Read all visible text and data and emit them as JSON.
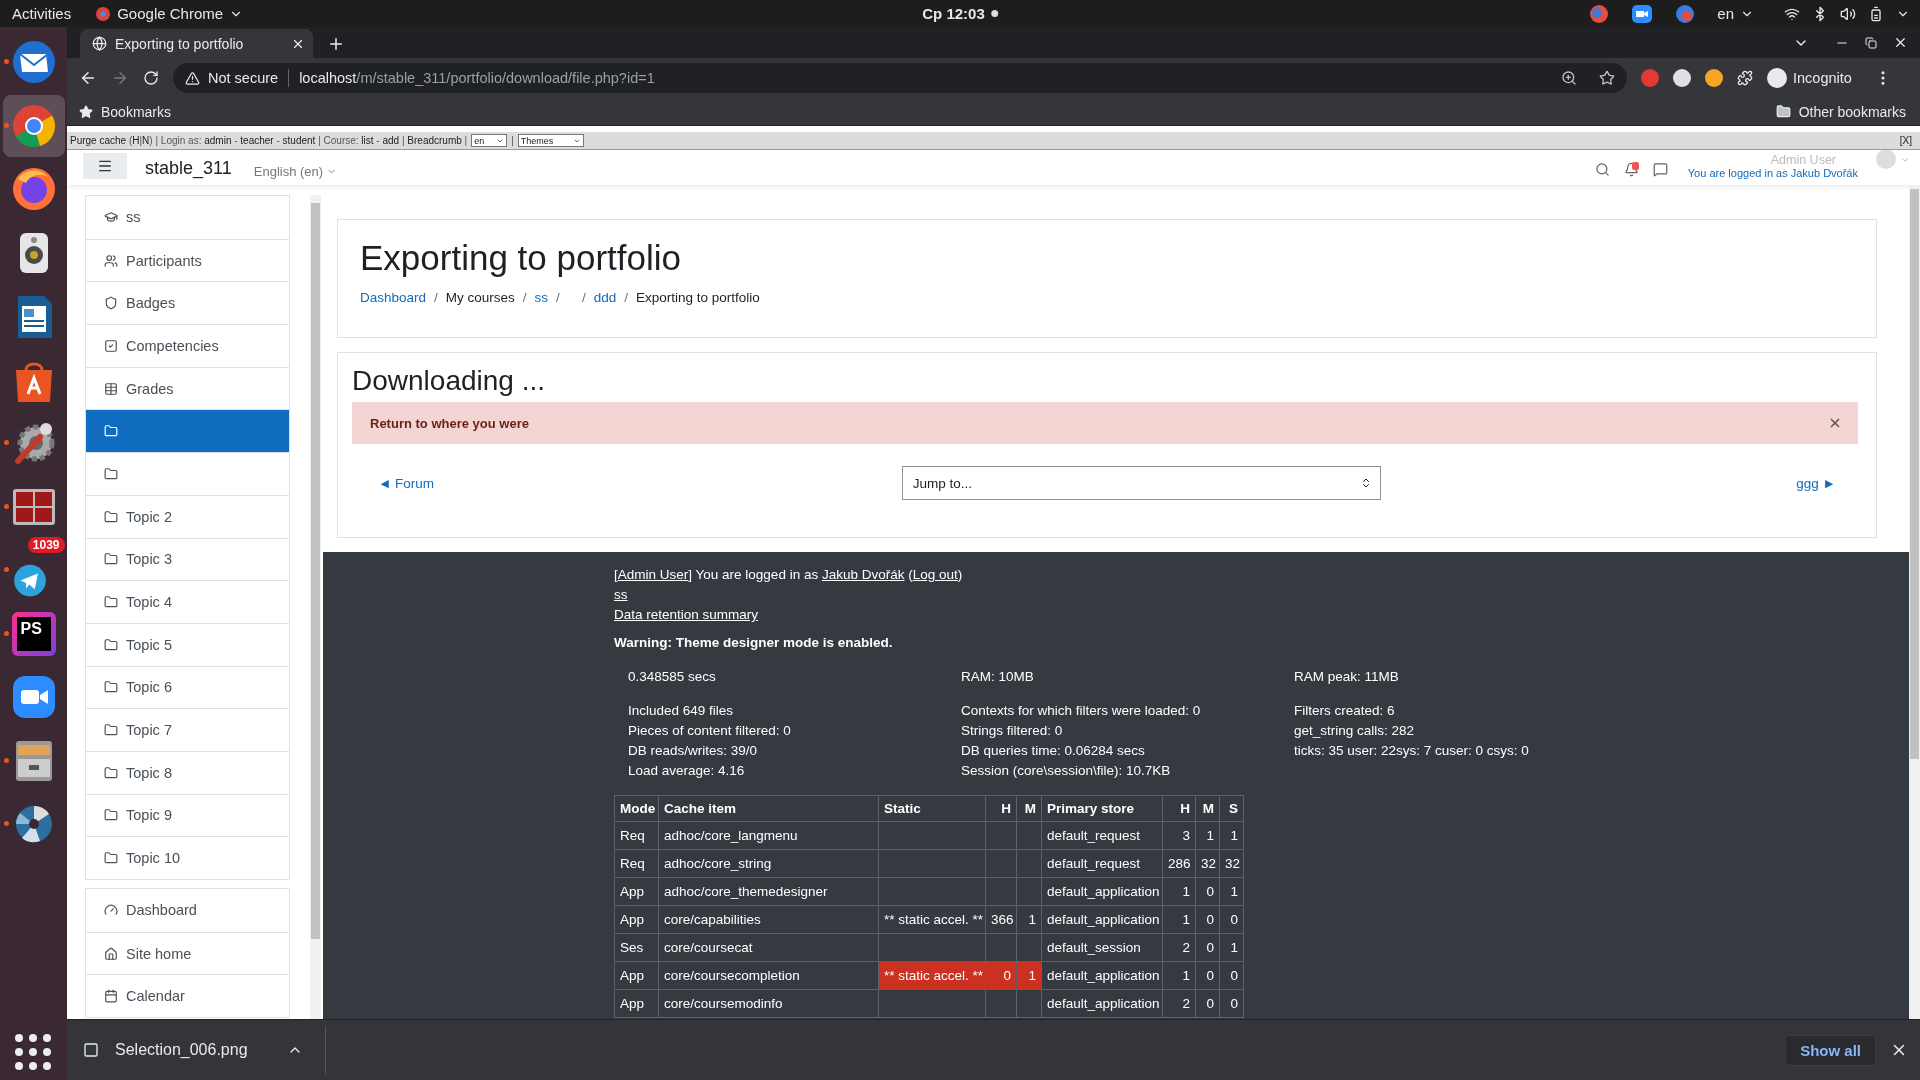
{
  "topbar": {
    "activities": "Activities",
    "app_menu": "Google Chrome",
    "clock": "Ср 12:03",
    "language": "en"
  },
  "dock": [
    {
      "kind": "mail",
      "running": true,
      "selected": false
    },
    {
      "kind": "browser",
      "running": true,
      "selected": true
    },
    {
      "kind": "firefox",
      "running": false,
      "selected": false
    },
    {
      "kind": "speaker",
      "running": false,
      "selected": false
    },
    {
      "kind": "document",
      "running": false,
      "selected": false
    },
    {
      "kind": "bag",
      "running": false,
      "selected": false
    },
    {
      "kind": "tools",
      "running": true,
      "selected": false
    },
    {
      "kind": "terminal",
      "running": true,
      "selected": false
    },
    {
      "kind": "plane",
      "running": true,
      "selected": false,
      "badge": "1039"
    },
    {
      "kind": "ide",
      "running": true,
      "selected": false,
      "label": "PS"
    },
    {
      "kind": "video",
      "running": false,
      "selected": false
    },
    {
      "kind": "cabinet",
      "running": true,
      "selected": false
    },
    {
      "kind": "aperture",
      "running": true,
      "selected": false
    }
  ],
  "browser": {
    "tab_title": "Exporting to portfolio",
    "security": "Not secure",
    "url_host": "localhost",
    "url_path": "/m/stable_311/portfolio/download/file.php?id=1",
    "profile": "Incognito",
    "bookmarks": "Bookmarks",
    "other_bookmarks": "Other bookmarks"
  },
  "devbar": {
    "segments": [
      {
        "text": "Purge cache",
        "kind": "link"
      },
      {
        "text": " (",
        "kind": "text"
      },
      {
        "text": "H",
        "kind": "link"
      },
      {
        "text": "|",
        "kind": "text"
      },
      {
        "text": "N",
        "kind": "link"
      },
      {
        "text": ") | Login as: ",
        "kind": "text"
      },
      {
        "text": "admin",
        "kind": "link"
      },
      {
        "text": " - ",
        "kind": "text"
      },
      {
        "text": "teacher",
        "kind": "link"
      },
      {
        "text": " - ",
        "kind": "text"
      },
      {
        "text": "student",
        "kind": "link"
      },
      {
        "text": " | Course: ",
        "kind": "text"
      },
      {
        "text": "list",
        "kind": "link"
      },
      {
        "text": " - ",
        "kind": "text"
      },
      {
        "text": "add",
        "kind": "link"
      },
      {
        "text": " | ",
        "kind": "text"
      },
      {
        "text": "Breadcrumb",
        "kind": "link"
      },
      {
        "text": " |",
        "kind": "text"
      }
    ],
    "language": "en",
    "divider": "|",
    "theme": "Themes",
    "close": "[X]"
  },
  "navbar": {
    "site": "stable_311",
    "language": "English (en)",
    "user": "Admin User",
    "login_note": "You are logged in as Jakub Dvořák"
  },
  "sidebar": {
    "groups": [
      [
        {
          "kind": "cap",
          "label": "ss",
          "selected": false
        },
        {
          "kind": "users",
          "label": "Participants",
          "selected": false
        },
        {
          "kind": "shield",
          "label": "Badges",
          "selected": false
        },
        {
          "kind": "check",
          "label": "Competencies",
          "selected": false
        },
        {
          "kind": "table",
          "label": "Grades",
          "selected": false
        },
        {
          "kind": "folder",
          "selected": true
        },
        {
          "kind": "folder",
          "selected": false
        },
        {
          "kind": "folder",
          "label": "Topic 2",
          "selected": false
        },
        {
          "kind": "folder",
          "label": "Topic 3",
          "selected": false
        },
        {
          "kind": "folder",
          "label": "Topic 4",
          "selected": false
        },
        {
          "kind": "folder",
          "label": "Topic 5",
          "selected": false
        },
        {
          "kind": "folder",
          "label": "Topic 6",
          "selected": false
        },
        {
          "kind": "folder",
          "label": "Topic 7",
          "selected": false
        },
        {
          "kind": "folder",
          "label": "Topic 8",
          "selected": false
        },
        {
          "kind": "folder",
          "label": "Topic 9",
          "selected": false
        },
        {
          "kind": "folder",
          "label": "Topic 10",
          "selected": false
        }
      ],
      [
        {
          "kind": "gauge",
          "label": "Dashboard",
          "selected": false
        },
        {
          "kind": "home",
          "label": "Site home",
          "selected": false
        },
        {
          "kind": "calendar",
          "label": "Calendar",
          "selected": false
        }
      ]
    ]
  },
  "header": {
    "title": "Exporting to portfolio",
    "separator": "/",
    "breadcrumb": [
      {
        "text": "Dashboard",
        "kind": "link"
      },
      {
        "text": "My courses",
        "kind": "text"
      },
      {
        "text": "ss",
        "kind": "link"
      },
      {
        "kind": "empty"
      },
      {
        "text": "ddd",
        "kind": "link"
      },
      {
        "text": "Exporting to portfolio",
        "kind": "text"
      }
    ]
  },
  "content": {
    "heading": "Downloading ...",
    "alert": "Return to where you were",
    "prev": "◄ Forum",
    "jump": "Jump to...",
    "next": "ggg ►"
  },
  "footer": {
    "login_line": [
      {
        "text": "[",
        "kind": "text"
      },
      {
        "text": "Admin User",
        "kind": "link"
      },
      {
        "text": "] You are logged in as ",
        "kind": "text"
      },
      {
        "text": "Jakub Dvořák",
        "kind": "link"
      },
      {
        "text": " (",
        "kind": "text"
      },
      {
        "text": "Log out",
        "kind": "link"
      },
      {
        "text": ")",
        "kind": "text"
      }
    ],
    "links": [
      "ss",
      "Data retention summary"
    ],
    "warning": "Warning: Theme designer mode is enabled.",
    "perf": [
      [
        [
          "0.348585 secs"
        ],
        [
          "RAM: 10MB"
        ],
        [
          "RAM peak: 11MB"
        ]
      ],
      [
        [
          "Included 649 files",
          "Pieces of content filtered: 0",
          "DB reads/writes: 39/0",
          "Load average: 4.16"
        ],
        [
          "Contexts for which filters were loaded: 0",
          "Strings filtered: 0",
          "DB queries time: 0.06284 secs",
          "Session (core\\session\\file): 10.7KB"
        ],
        [
          "Filters created: 6",
          "get_string calls: 282",
          "ticks: 35 user: 22sys: 7 cuser: 0 csys: 0"
        ]
      ]
    ]
  },
  "cache_table": {
    "columns": [
      "Mode",
      "Cache item",
      "Static",
      "H",
      "M",
      "Primary store",
      "H",
      "M",
      "S"
    ],
    "rows": [
      {
        "mode": "Req",
        "item": "adhoc/core_langmenu",
        "store": "default_request",
        "h": "3",
        "m": "1",
        "s": "1",
        "warning": false
      },
      {
        "mode": "Req",
        "item": "adhoc/core_string",
        "store": "default_request",
        "h": "286",
        "m": "32",
        "s": "32",
        "warning": false
      },
      {
        "mode": "App",
        "item": "adhoc/core_themedesigner",
        "store": "default_application",
        "h": "1",
        "m": "0",
        "s": "1",
        "warning": false
      },
      {
        "mode": "App",
        "item": "core/capabilities",
        "static": "** static accel. **",
        "static_h": "366",
        "static_m": "1",
        "store": "default_application",
        "h": "1",
        "m": "0",
        "s": "0",
        "warning": false
      },
      {
        "mode": "Ses",
        "item": "core/coursecat",
        "store": "default_session",
        "h": "2",
        "m": "0",
        "s": "1",
        "warning": false
      },
      {
        "mode": "App",
        "item": "core/coursecompletion",
        "static": "** static accel. **",
        "static_h": "0",
        "static_m": "1",
        "store": "default_application",
        "h": "1",
        "m": "0",
        "s": "0",
        "warning": true
      },
      {
        "mode": "App",
        "item": "core/coursemodinfo",
        "store": "default_application",
        "h": "2",
        "m": "0",
        "s": "0",
        "warning": false
      }
    ]
  },
  "downloads": {
    "file": "Selection_006.png",
    "show_all": "Show all"
  }
}
